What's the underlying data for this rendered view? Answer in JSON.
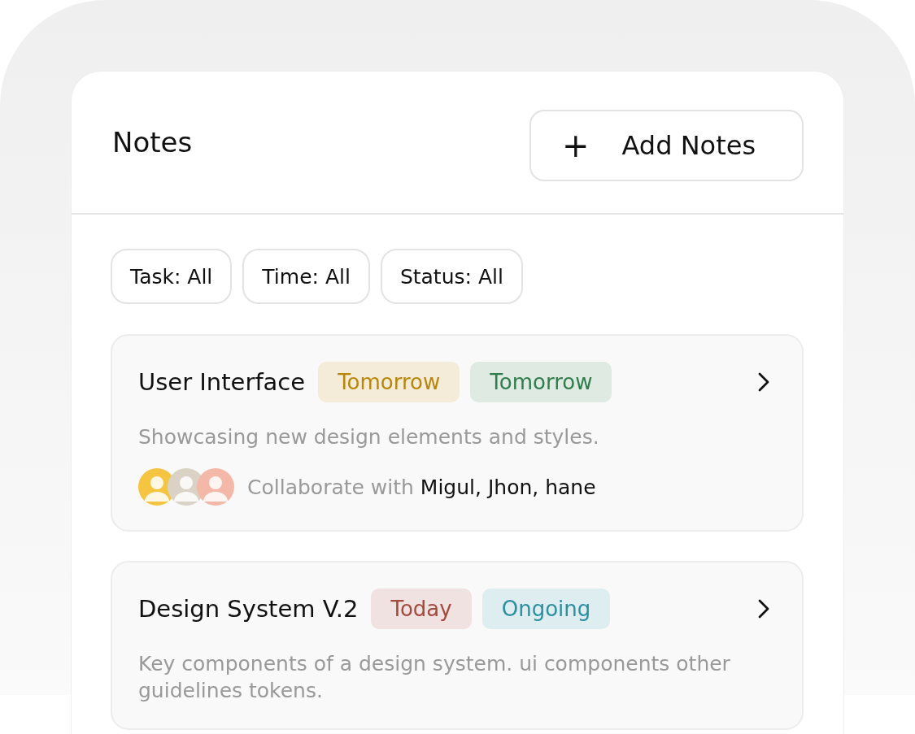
{
  "header": {
    "title": "Notes",
    "add_button": {
      "icon": "+",
      "label": "Add Notes"
    }
  },
  "filters": [
    {
      "label": "Task: All"
    },
    {
      "label": "Time: All"
    },
    {
      "label": "Status: All"
    }
  ],
  "notes": [
    {
      "title": "User Interface",
      "tags": [
        {
          "label": "Tomorrow",
          "color": "#b8860b"
        },
        {
          "label": "Tomorrow",
          "color": "#2e7d4a"
        }
      ],
      "description": "Showcasing new design elements and styles.",
      "avatars": [
        {
          "color": "#f5c542"
        },
        {
          "color": "#d9d2c5"
        },
        {
          "color": "#f4b8a8"
        }
      ],
      "collaboration": {
        "label": "Collaborate with",
        "names": "Migul, Jhon, hane"
      }
    },
    {
      "title": "Design System V.2",
      "tags": [
        {
          "label": "Today",
          "color": "#a34a3f"
        },
        {
          "label": "Ongoing",
          "color": "#2a8fa0"
        }
      ],
      "description": "Key components of a design system. ui components other guidelines tokens."
    }
  ]
}
